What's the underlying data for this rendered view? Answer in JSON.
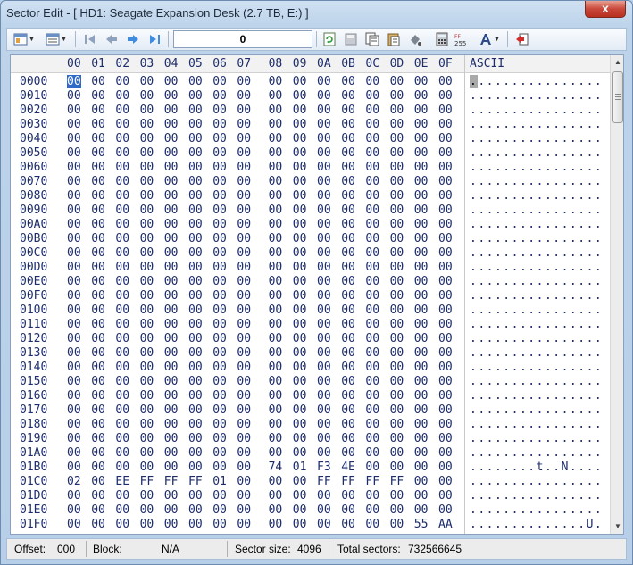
{
  "window": {
    "title": "Sector Edit - [ HD1: Seagate Expansion Desk (2.7 TB, E:) ]",
    "close_glyph": "x"
  },
  "toolbar": {
    "sector_value": "0",
    "icons": [
      "view-mode-icon",
      "columns-icon",
      "first-sector-icon",
      "prev-sector-icon",
      "next-sector-icon",
      "last-sector-icon",
      "refresh-icon",
      "save-icon",
      "copy-sector-icon",
      "paste-sector-icon",
      "fill-icon",
      "calculator-icon",
      "data-interpreter-icon",
      "font-icon",
      "exit-icon"
    ]
  },
  "hex": {
    "columns": [
      "00",
      "01",
      "02",
      "03",
      "04",
      "05",
      "06",
      "07",
      "08",
      "09",
      "0A",
      "0B",
      "0C",
      "0D",
      "0E",
      "0F"
    ],
    "ascii_header": "ASCII",
    "rows": [
      {
        "addr": "0000",
        "bytes": [
          "00",
          "00",
          "00",
          "00",
          "00",
          "00",
          "00",
          "00",
          "00",
          "00",
          "00",
          "00",
          "00",
          "00",
          "00",
          "00"
        ],
        "ascii": "................"
      },
      {
        "addr": "0010",
        "bytes": [
          "00",
          "00",
          "00",
          "00",
          "00",
          "00",
          "00",
          "00",
          "00",
          "00",
          "00",
          "00",
          "00",
          "00",
          "00",
          "00"
        ],
        "ascii": "................"
      },
      {
        "addr": "0020",
        "bytes": [
          "00",
          "00",
          "00",
          "00",
          "00",
          "00",
          "00",
          "00",
          "00",
          "00",
          "00",
          "00",
          "00",
          "00",
          "00",
          "00"
        ],
        "ascii": "................"
      },
      {
        "addr": "0030",
        "bytes": [
          "00",
          "00",
          "00",
          "00",
          "00",
          "00",
          "00",
          "00",
          "00",
          "00",
          "00",
          "00",
          "00",
          "00",
          "00",
          "00"
        ],
        "ascii": "................"
      },
      {
        "addr": "0040",
        "bytes": [
          "00",
          "00",
          "00",
          "00",
          "00",
          "00",
          "00",
          "00",
          "00",
          "00",
          "00",
          "00",
          "00",
          "00",
          "00",
          "00"
        ],
        "ascii": "................"
      },
      {
        "addr": "0050",
        "bytes": [
          "00",
          "00",
          "00",
          "00",
          "00",
          "00",
          "00",
          "00",
          "00",
          "00",
          "00",
          "00",
          "00",
          "00",
          "00",
          "00"
        ],
        "ascii": "................"
      },
      {
        "addr": "0060",
        "bytes": [
          "00",
          "00",
          "00",
          "00",
          "00",
          "00",
          "00",
          "00",
          "00",
          "00",
          "00",
          "00",
          "00",
          "00",
          "00",
          "00"
        ],
        "ascii": "................"
      },
      {
        "addr": "0070",
        "bytes": [
          "00",
          "00",
          "00",
          "00",
          "00",
          "00",
          "00",
          "00",
          "00",
          "00",
          "00",
          "00",
          "00",
          "00",
          "00",
          "00"
        ],
        "ascii": "................"
      },
      {
        "addr": "0080",
        "bytes": [
          "00",
          "00",
          "00",
          "00",
          "00",
          "00",
          "00",
          "00",
          "00",
          "00",
          "00",
          "00",
          "00",
          "00",
          "00",
          "00"
        ],
        "ascii": "................"
      },
      {
        "addr": "0090",
        "bytes": [
          "00",
          "00",
          "00",
          "00",
          "00",
          "00",
          "00",
          "00",
          "00",
          "00",
          "00",
          "00",
          "00",
          "00",
          "00",
          "00"
        ],
        "ascii": "................"
      },
      {
        "addr": "00A0",
        "bytes": [
          "00",
          "00",
          "00",
          "00",
          "00",
          "00",
          "00",
          "00",
          "00",
          "00",
          "00",
          "00",
          "00",
          "00",
          "00",
          "00"
        ],
        "ascii": "................"
      },
      {
        "addr": "00B0",
        "bytes": [
          "00",
          "00",
          "00",
          "00",
          "00",
          "00",
          "00",
          "00",
          "00",
          "00",
          "00",
          "00",
          "00",
          "00",
          "00",
          "00"
        ],
        "ascii": "................"
      },
      {
        "addr": "00C0",
        "bytes": [
          "00",
          "00",
          "00",
          "00",
          "00",
          "00",
          "00",
          "00",
          "00",
          "00",
          "00",
          "00",
          "00",
          "00",
          "00",
          "00"
        ],
        "ascii": "................"
      },
      {
        "addr": "00D0",
        "bytes": [
          "00",
          "00",
          "00",
          "00",
          "00",
          "00",
          "00",
          "00",
          "00",
          "00",
          "00",
          "00",
          "00",
          "00",
          "00",
          "00"
        ],
        "ascii": "................"
      },
      {
        "addr": "00E0",
        "bytes": [
          "00",
          "00",
          "00",
          "00",
          "00",
          "00",
          "00",
          "00",
          "00",
          "00",
          "00",
          "00",
          "00",
          "00",
          "00",
          "00"
        ],
        "ascii": "................"
      },
      {
        "addr": "00F0",
        "bytes": [
          "00",
          "00",
          "00",
          "00",
          "00",
          "00",
          "00",
          "00",
          "00",
          "00",
          "00",
          "00",
          "00",
          "00",
          "00",
          "00"
        ],
        "ascii": "................"
      },
      {
        "addr": "0100",
        "bytes": [
          "00",
          "00",
          "00",
          "00",
          "00",
          "00",
          "00",
          "00",
          "00",
          "00",
          "00",
          "00",
          "00",
          "00",
          "00",
          "00"
        ],
        "ascii": "................"
      },
      {
        "addr": "0110",
        "bytes": [
          "00",
          "00",
          "00",
          "00",
          "00",
          "00",
          "00",
          "00",
          "00",
          "00",
          "00",
          "00",
          "00",
          "00",
          "00",
          "00"
        ],
        "ascii": "................"
      },
      {
        "addr": "0120",
        "bytes": [
          "00",
          "00",
          "00",
          "00",
          "00",
          "00",
          "00",
          "00",
          "00",
          "00",
          "00",
          "00",
          "00",
          "00",
          "00",
          "00"
        ],
        "ascii": "................"
      },
      {
        "addr": "0130",
        "bytes": [
          "00",
          "00",
          "00",
          "00",
          "00",
          "00",
          "00",
          "00",
          "00",
          "00",
          "00",
          "00",
          "00",
          "00",
          "00",
          "00"
        ],
        "ascii": "................"
      },
      {
        "addr": "0140",
        "bytes": [
          "00",
          "00",
          "00",
          "00",
          "00",
          "00",
          "00",
          "00",
          "00",
          "00",
          "00",
          "00",
          "00",
          "00",
          "00",
          "00"
        ],
        "ascii": "................"
      },
      {
        "addr": "0150",
        "bytes": [
          "00",
          "00",
          "00",
          "00",
          "00",
          "00",
          "00",
          "00",
          "00",
          "00",
          "00",
          "00",
          "00",
          "00",
          "00",
          "00"
        ],
        "ascii": "................"
      },
      {
        "addr": "0160",
        "bytes": [
          "00",
          "00",
          "00",
          "00",
          "00",
          "00",
          "00",
          "00",
          "00",
          "00",
          "00",
          "00",
          "00",
          "00",
          "00",
          "00"
        ],
        "ascii": "................"
      },
      {
        "addr": "0170",
        "bytes": [
          "00",
          "00",
          "00",
          "00",
          "00",
          "00",
          "00",
          "00",
          "00",
          "00",
          "00",
          "00",
          "00",
          "00",
          "00",
          "00"
        ],
        "ascii": "................"
      },
      {
        "addr": "0180",
        "bytes": [
          "00",
          "00",
          "00",
          "00",
          "00",
          "00",
          "00",
          "00",
          "00",
          "00",
          "00",
          "00",
          "00",
          "00",
          "00",
          "00"
        ],
        "ascii": "................"
      },
      {
        "addr": "0190",
        "bytes": [
          "00",
          "00",
          "00",
          "00",
          "00",
          "00",
          "00",
          "00",
          "00",
          "00",
          "00",
          "00",
          "00",
          "00",
          "00",
          "00"
        ],
        "ascii": "................"
      },
      {
        "addr": "01A0",
        "bytes": [
          "00",
          "00",
          "00",
          "00",
          "00",
          "00",
          "00",
          "00",
          "00",
          "00",
          "00",
          "00",
          "00",
          "00",
          "00",
          "00"
        ],
        "ascii": "................"
      },
      {
        "addr": "01B0",
        "bytes": [
          "00",
          "00",
          "00",
          "00",
          "00",
          "00",
          "00",
          "00",
          "74",
          "01",
          "F3",
          "4E",
          "00",
          "00",
          "00",
          "00"
        ],
        "ascii": "........t..N...."
      },
      {
        "addr": "01C0",
        "bytes": [
          "02",
          "00",
          "EE",
          "FF",
          "FF",
          "FF",
          "01",
          "00",
          "00",
          "00",
          "FF",
          "FF",
          "FF",
          "FF",
          "00",
          "00"
        ],
        "ascii": "................"
      },
      {
        "addr": "01D0",
        "bytes": [
          "00",
          "00",
          "00",
          "00",
          "00",
          "00",
          "00",
          "00",
          "00",
          "00",
          "00",
          "00",
          "00",
          "00",
          "00",
          "00"
        ],
        "ascii": "................"
      },
      {
        "addr": "01E0",
        "bytes": [
          "00",
          "00",
          "00",
          "00",
          "00",
          "00",
          "00",
          "00",
          "00",
          "00",
          "00",
          "00",
          "00",
          "00",
          "00",
          "00"
        ],
        "ascii": "................"
      },
      {
        "addr": "01F0",
        "bytes": [
          "00",
          "00",
          "00",
          "00",
          "00",
          "00",
          "00",
          "00",
          "00",
          "00",
          "00",
          "00",
          "00",
          "00",
          "55",
          "AA"
        ],
        "ascii": "..............U."
      }
    ]
  },
  "status": {
    "offset_label": "Offset:",
    "offset_value": "000",
    "block_label": "Block:",
    "block_value": "N/A",
    "sector_size_label": "Sector size:",
    "sector_size_value": "4096",
    "total_sectors_label": "Total sectors:",
    "total_sectors_value": "732566645"
  }
}
